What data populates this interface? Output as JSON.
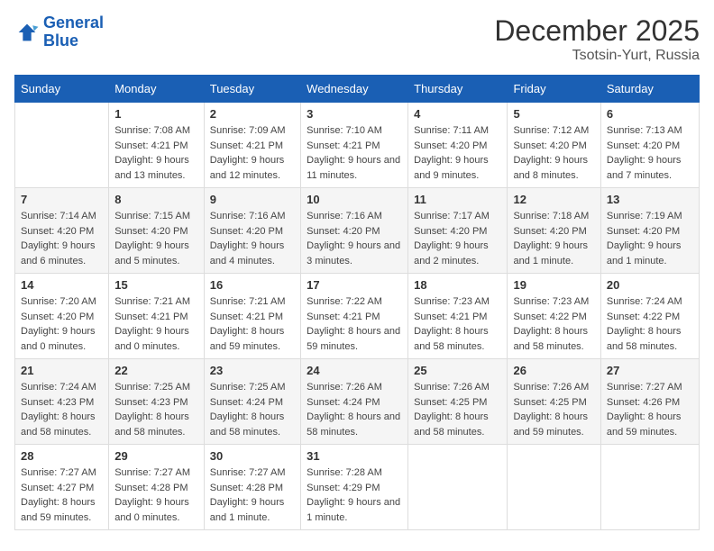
{
  "header": {
    "logo_line1": "General",
    "logo_line2": "Blue",
    "title": "December 2025",
    "subtitle": "Tsotsin-Yurt, Russia"
  },
  "days_of_week": [
    "Sunday",
    "Monday",
    "Tuesday",
    "Wednesday",
    "Thursday",
    "Friday",
    "Saturday"
  ],
  "weeks": [
    [
      {
        "num": "",
        "sunrise": "",
        "sunset": "",
        "daylight": ""
      },
      {
        "num": "1",
        "sunrise": "7:08 AM",
        "sunset": "4:21 PM",
        "daylight": "9 hours and 13 minutes."
      },
      {
        "num": "2",
        "sunrise": "7:09 AM",
        "sunset": "4:21 PM",
        "daylight": "9 hours and 12 minutes."
      },
      {
        "num": "3",
        "sunrise": "7:10 AM",
        "sunset": "4:21 PM",
        "daylight": "9 hours and 11 minutes."
      },
      {
        "num": "4",
        "sunrise": "7:11 AM",
        "sunset": "4:20 PM",
        "daylight": "9 hours and 9 minutes."
      },
      {
        "num": "5",
        "sunrise": "7:12 AM",
        "sunset": "4:20 PM",
        "daylight": "9 hours and 8 minutes."
      },
      {
        "num": "6",
        "sunrise": "7:13 AM",
        "sunset": "4:20 PM",
        "daylight": "9 hours and 7 minutes."
      }
    ],
    [
      {
        "num": "7",
        "sunrise": "7:14 AM",
        "sunset": "4:20 PM",
        "daylight": "9 hours and 6 minutes."
      },
      {
        "num": "8",
        "sunrise": "7:15 AM",
        "sunset": "4:20 PM",
        "daylight": "9 hours and 5 minutes."
      },
      {
        "num": "9",
        "sunrise": "7:16 AM",
        "sunset": "4:20 PM",
        "daylight": "9 hours and 4 minutes."
      },
      {
        "num": "10",
        "sunrise": "7:16 AM",
        "sunset": "4:20 PM",
        "daylight": "9 hours and 3 minutes."
      },
      {
        "num": "11",
        "sunrise": "7:17 AM",
        "sunset": "4:20 PM",
        "daylight": "9 hours and 2 minutes."
      },
      {
        "num": "12",
        "sunrise": "7:18 AM",
        "sunset": "4:20 PM",
        "daylight": "9 hours and 1 minute."
      },
      {
        "num": "13",
        "sunrise": "7:19 AM",
        "sunset": "4:20 PM",
        "daylight": "9 hours and 1 minute."
      }
    ],
    [
      {
        "num": "14",
        "sunrise": "7:20 AM",
        "sunset": "4:20 PM",
        "daylight": "9 hours and 0 minutes."
      },
      {
        "num": "15",
        "sunrise": "7:21 AM",
        "sunset": "4:21 PM",
        "daylight": "9 hours and 0 minutes."
      },
      {
        "num": "16",
        "sunrise": "7:21 AM",
        "sunset": "4:21 PM",
        "daylight": "8 hours and 59 minutes."
      },
      {
        "num": "17",
        "sunrise": "7:22 AM",
        "sunset": "4:21 PM",
        "daylight": "8 hours and 59 minutes."
      },
      {
        "num": "18",
        "sunrise": "7:23 AM",
        "sunset": "4:21 PM",
        "daylight": "8 hours and 58 minutes."
      },
      {
        "num": "19",
        "sunrise": "7:23 AM",
        "sunset": "4:22 PM",
        "daylight": "8 hours and 58 minutes."
      },
      {
        "num": "20",
        "sunrise": "7:24 AM",
        "sunset": "4:22 PM",
        "daylight": "8 hours and 58 minutes."
      }
    ],
    [
      {
        "num": "21",
        "sunrise": "7:24 AM",
        "sunset": "4:23 PM",
        "daylight": "8 hours and 58 minutes."
      },
      {
        "num": "22",
        "sunrise": "7:25 AM",
        "sunset": "4:23 PM",
        "daylight": "8 hours and 58 minutes."
      },
      {
        "num": "23",
        "sunrise": "7:25 AM",
        "sunset": "4:24 PM",
        "daylight": "8 hours and 58 minutes."
      },
      {
        "num": "24",
        "sunrise": "7:26 AM",
        "sunset": "4:24 PM",
        "daylight": "8 hours and 58 minutes."
      },
      {
        "num": "25",
        "sunrise": "7:26 AM",
        "sunset": "4:25 PM",
        "daylight": "8 hours and 58 minutes."
      },
      {
        "num": "26",
        "sunrise": "7:26 AM",
        "sunset": "4:25 PM",
        "daylight": "8 hours and 59 minutes."
      },
      {
        "num": "27",
        "sunrise": "7:27 AM",
        "sunset": "4:26 PM",
        "daylight": "8 hours and 59 minutes."
      }
    ],
    [
      {
        "num": "28",
        "sunrise": "7:27 AM",
        "sunset": "4:27 PM",
        "daylight": "8 hours and 59 minutes."
      },
      {
        "num": "29",
        "sunrise": "7:27 AM",
        "sunset": "4:28 PM",
        "daylight": "9 hours and 0 minutes."
      },
      {
        "num": "30",
        "sunrise": "7:27 AM",
        "sunset": "4:28 PM",
        "daylight": "9 hours and 1 minute."
      },
      {
        "num": "31",
        "sunrise": "7:28 AM",
        "sunset": "4:29 PM",
        "daylight": "9 hours and 1 minute."
      },
      {
        "num": "",
        "sunrise": "",
        "sunset": "",
        "daylight": ""
      },
      {
        "num": "",
        "sunrise": "",
        "sunset": "",
        "daylight": ""
      },
      {
        "num": "",
        "sunrise": "",
        "sunset": "",
        "daylight": ""
      }
    ]
  ],
  "labels": {
    "sunrise_prefix": "Sunrise: ",
    "sunset_prefix": "Sunset: ",
    "daylight_prefix": "Daylight: "
  }
}
